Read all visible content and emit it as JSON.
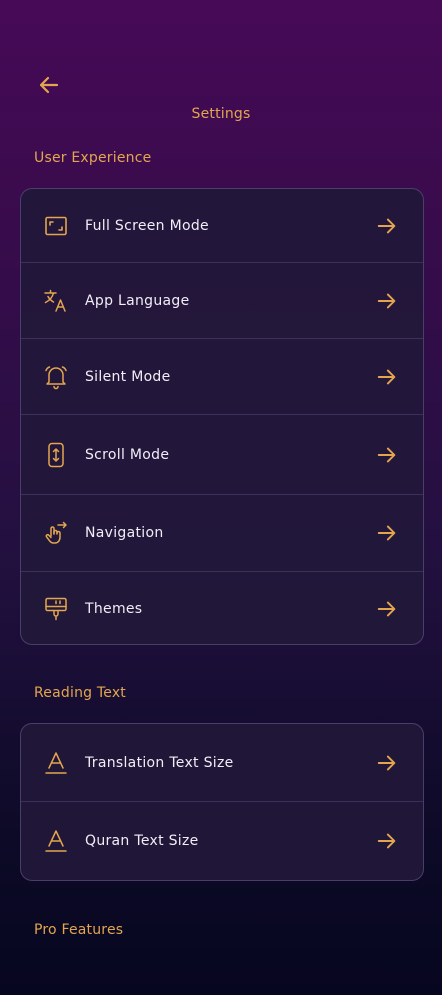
{
  "header": {
    "back_icon": "arrow-left-icon",
    "title": "Settings"
  },
  "colors": {
    "accent": "#e3a64f",
    "text": "#f1eef7",
    "card_bg": "#22183a"
  },
  "sections": [
    {
      "title": "User Experience",
      "items": [
        {
          "label": "Full Screen Mode",
          "icon": "fullscreen-icon"
        },
        {
          "label": "App Language",
          "icon": "translate-icon"
        },
        {
          "label": "Silent Mode",
          "icon": "alarm-bell-icon"
        },
        {
          "label": "Scroll Mode",
          "icon": "scroll-icon"
        },
        {
          "label": "Navigation",
          "icon": "swipe-hand-icon"
        },
        {
          "label": "Themes",
          "icon": "paint-roller-icon"
        }
      ]
    },
    {
      "title": "Reading Text",
      "items": [
        {
          "label": "Translation Text Size",
          "icon": "text-size-icon"
        },
        {
          "label": "Quran Text Size",
          "icon": "text-size-icon"
        }
      ]
    },
    {
      "title": "Pro Features",
      "items": []
    }
  ]
}
